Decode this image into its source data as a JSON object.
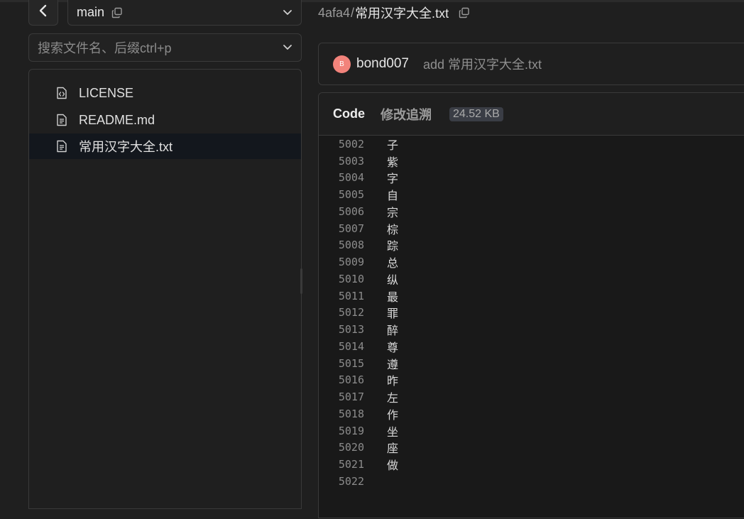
{
  "branch": {
    "name": "main"
  },
  "search": {
    "placeholder": "搜索文件名、后缀ctrl+p"
  },
  "file_tree": {
    "items": [
      {
        "label": "LICENSE",
        "icon": "file-code-icon"
      },
      {
        "label": "README.md",
        "icon": "file-text-icon"
      },
      {
        "label": "常用汉字大全.txt",
        "icon": "file-text-icon",
        "selected": true
      }
    ]
  },
  "breadcrumb": {
    "repo": "4afa4",
    "separator": "/",
    "file": "常用汉字大全.txt"
  },
  "commit": {
    "avatar_letter": "B",
    "author": "bond007",
    "message": "add 常用汉字大全.txt"
  },
  "code_view": {
    "tab_code": "Code",
    "tab_blame": "修改追溯",
    "file_size": "24.52 KB",
    "lines": [
      {
        "no": "5002",
        "text": "子"
      },
      {
        "no": "5003",
        "text": "紫"
      },
      {
        "no": "5004",
        "text": "字"
      },
      {
        "no": "5005",
        "text": "自"
      },
      {
        "no": "5006",
        "text": "宗"
      },
      {
        "no": "5007",
        "text": "棕"
      },
      {
        "no": "5008",
        "text": "踪"
      },
      {
        "no": "5009",
        "text": "总"
      },
      {
        "no": "5010",
        "text": "纵"
      },
      {
        "no": "5011",
        "text": "最"
      },
      {
        "no": "5012",
        "text": "罪"
      },
      {
        "no": "5013",
        "text": "醉"
      },
      {
        "no": "5014",
        "text": "尊"
      },
      {
        "no": "5015",
        "text": "遵"
      },
      {
        "no": "5016",
        "text": "昨"
      },
      {
        "no": "5017",
        "text": "左"
      },
      {
        "no": "5018",
        "text": "作"
      },
      {
        "no": "5019",
        "text": "坐"
      },
      {
        "no": "5020",
        "text": "座"
      },
      {
        "no": "5021",
        "text": "做"
      },
      {
        "no": "5022",
        "text": ""
      }
    ]
  },
  "colors": {
    "background": "#1f1f1f",
    "border": "#3a3a3a",
    "avatar": "#f2837b",
    "selected_row": "#13171d",
    "badge": "#3a3d45"
  }
}
